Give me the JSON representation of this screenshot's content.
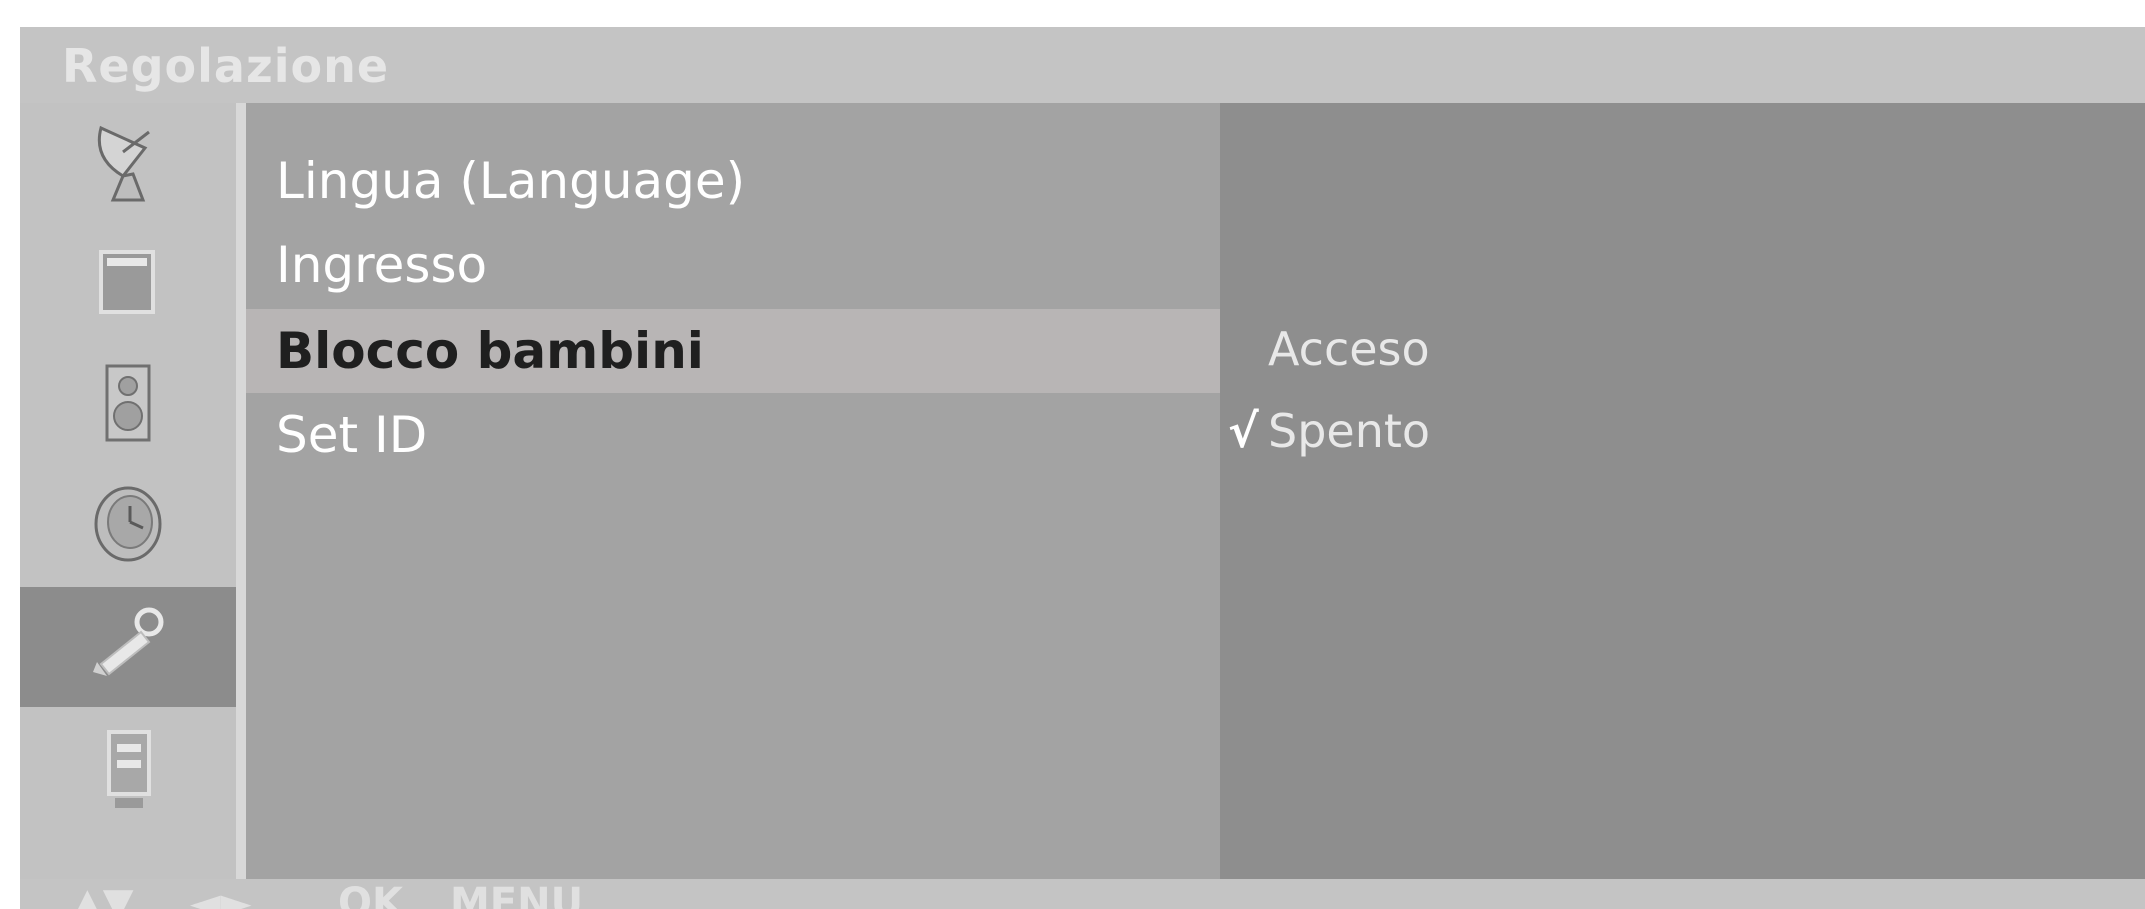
{
  "title": "Regolazione",
  "sidebar": {
    "items": [
      {
        "icon": "satellite-dish-icon",
        "active": false
      },
      {
        "icon": "picture-icon",
        "active": false
      },
      {
        "icon": "speaker-icon",
        "active": false
      },
      {
        "icon": "clock-icon",
        "active": false
      },
      {
        "icon": "wrench-icon",
        "active": true
      },
      {
        "icon": "dvd-recorder-icon",
        "active": false
      }
    ]
  },
  "menu": {
    "items": [
      {
        "label": "Lingua (Language)",
        "selected": false
      },
      {
        "label": "Ingresso",
        "selected": false
      },
      {
        "label": "Blocco bambini",
        "selected": true
      },
      {
        "label": "Set ID",
        "selected": false
      }
    ]
  },
  "options": {
    "items": [
      {
        "label": "Acceso",
        "checked": false,
        "mark": ""
      },
      {
        "label": "Spento",
        "checked": true,
        "mark": "√"
      }
    ]
  },
  "footer": {
    "updown": "▲▼",
    "leftright": "◄►",
    "ok": "OK",
    "menu": "MENU"
  },
  "colors": {
    "title_bar": "#c4c4c4",
    "sidebar": "#c2c2c2",
    "sidebar_active": "#8c8c8c",
    "menu_panel": "#a3a3a3",
    "menu_selected": "#b8b5b5",
    "options_panel": "#8e8e8e"
  }
}
